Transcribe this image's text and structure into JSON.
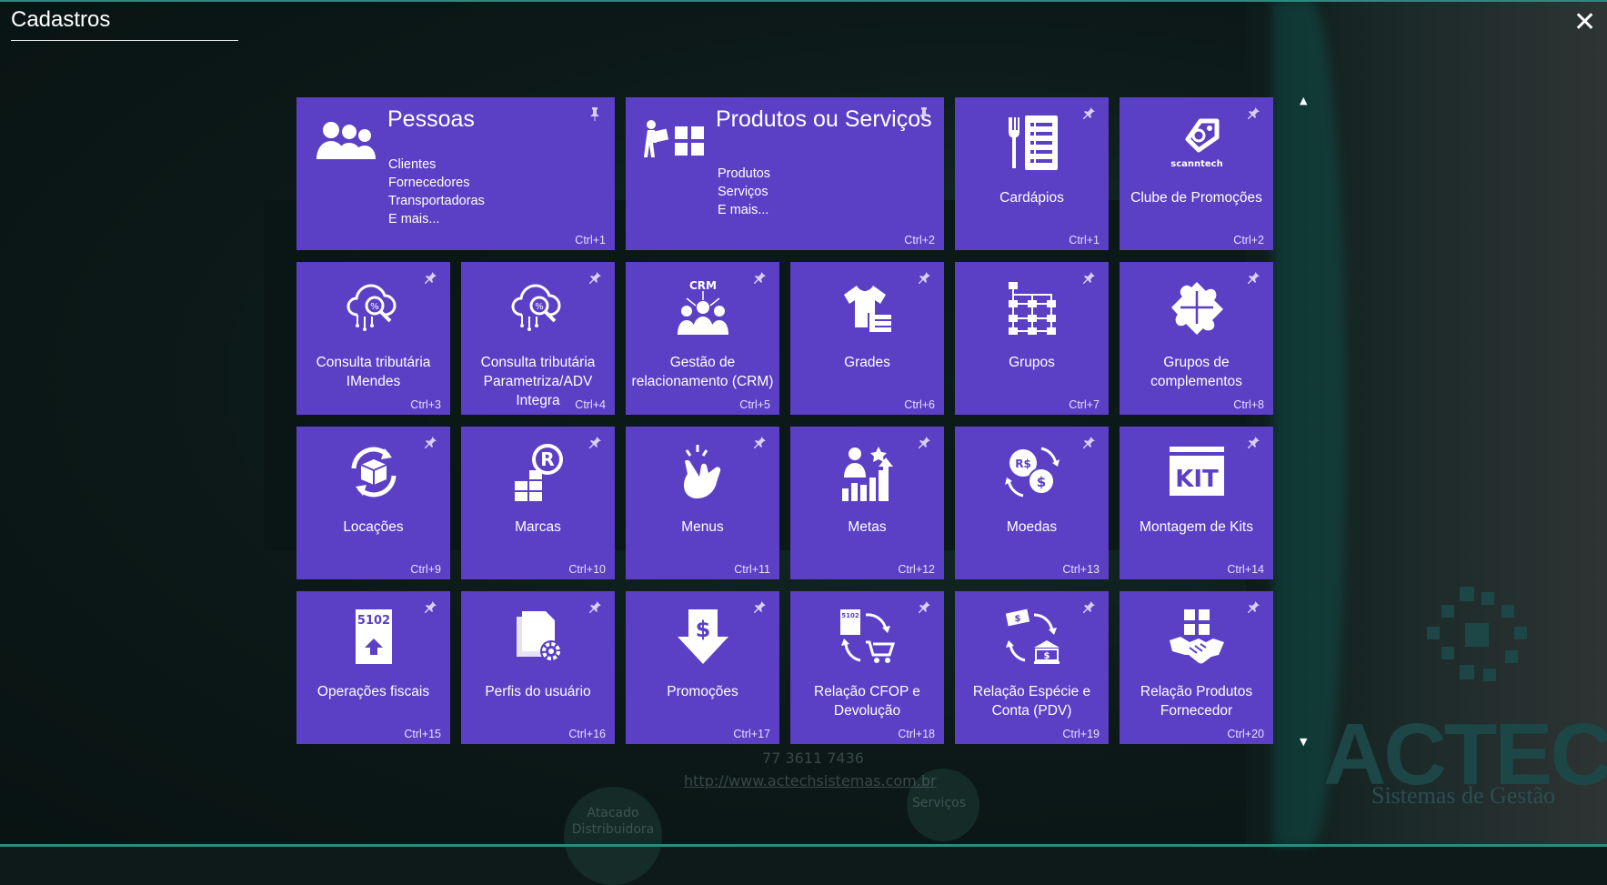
{
  "window": {
    "title": "Cadastros",
    "close_icon": "close-icon"
  },
  "background": {
    "brand": "ACTECH",
    "brand_sub": "Sistemas de Gestão",
    "phone": "77 3611 7436",
    "url": "http://www.actechsistemas.com.br",
    "bubble1": "Atacado Distribuidora",
    "bubble2": "Serviços"
  },
  "colors": {
    "tile": "#5b3fc4",
    "background": "#0d1a19",
    "accent": "#2c8a80"
  },
  "tiles": {
    "pessoas": {
      "title": "Pessoas",
      "lines": [
        "Clientes",
        "Fornecedores",
        "Transportadoras",
        "E mais..."
      ],
      "shortcut": "Ctrl+1",
      "icon": "people-icon"
    },
    "produtos": {
      "title": "Produtos ou Serviços",
      "lines": [
        "Produtos",
        "Serviços",
        "E mais..."
      ],
      "shortcut": "Ctrl+2",
      "icon": "boxes-icon"
    },
    "cardapios": {
      "label": "Cardápios",
      "shortcut": "Ctrl+1",
      "icon": "menu-card-icon"
    },
    "clube": {
      "label": "Clube de Promoções",
      "shortcut": "Ctrl+2",
      "icon": "scanntech-tag-icon",
      "icon_text": "scanntech"
    },
    "imendes": {
      "label1": "Consulta tributária",
      "label2": "IMendes",
      "shortcut": "Ctrl+3",
      "icon": "tax-cloud-icon"
    },
    "parametriza": {
      "label1": "Consulta tributária",
      "label2": "Parametriza/ADV",
      "label3": "Integra",
      "shortcut": "Ctrl+4",
      "icon": "tax-cloud-icon"
    },
    "crm": {
      "label1": "Gestão de",
      "label2": "relacionamento (CRM)",
      "shortcut": "Ctrl+5",
      "icon": "crm-icon",
      "icon_text": "CRM"
    },
    "grades": {
      "label": "Grades",
      "shortcut": "Ctrl+6",
      "icon": "tshirt-icon"
    },
    "grupos": {
      "label": "Grupos",
      "shortcut": "Ctrl+7",
      "icon": "hierarchy-icon"
    },
    "complementos": {
      "label1": "Grupos de",
      "label2": "complementos",
      "shortcut": "Ctrl+8",
      "icon": "puzzle-icon"
    },
    "locacoes": {
      "label": "Locações",
      "shortcut": "Ctrl+9",
      "icon": "box-cycle-icon"
    },
    "marcas": {
      "label": "Marcas",
      "shortcut": "Ctrl+10",
      "icon": "registered-icon"
    },
    "menus": {
      "label": "Menus",
      "shortcut": "Ctrl+11",
      "icon": "hand-tap-icon"
    },
    "metas": {
      "label": "Metas",
      "shortcut": "Ctrl+12",
      "icon": "goals-chart-icon"
    },
    "moedas": {
      "label": "Moedas",
      "shortcut": "Ctrl+13",
      "icon": "currency-exchange-icon",
      "icon_text1": "R$",
      "icon_text2": "$"
    },
    "kits": {
      "label": "Montagem de Kits",
      "shortcut": "Ctrl+14",
      "icon": "kit-icon",
      "icon_text": "KIT"
    },
    "operacoes": {
      "label": "Operações fiscais",
      "shortcut": "Ctrl+15",
      "icon": "cfop-document-icon",
      "icon_text": "5102"
    },
    "perfis": {
      "label": "Perfis do usuário",
      "shortcut": "Ctrl+16",
      "icon": "document-gear-icon"
    },
    "promocoes": {
      "label": "Promoções",
      "shortcut": "Ctrl+17",
      "icon": "dollar-down-icon"
    },
    "cfop": {
      "label1": "Relação CFOP e",
      "label2": "Devolução",
      "shortcut": "Ctrl+18",
      "icon": "cfop-return-icon",
      "icon_text": "5102"
    },
    "especie": {
      "label1": "Relação Espécie e",
      "label2": "Conta (PDV)",
      "shortcut": "Ctrl+19",
      "icon": "money-bank-icon"
    },
    "fornecedor": {
      "label1": "Relação Produtos",
      "label2": "Fornecedor",
      "shortcut": "Ctrl+20",
      "icon": "handshake-icon"
    }
  }
}
